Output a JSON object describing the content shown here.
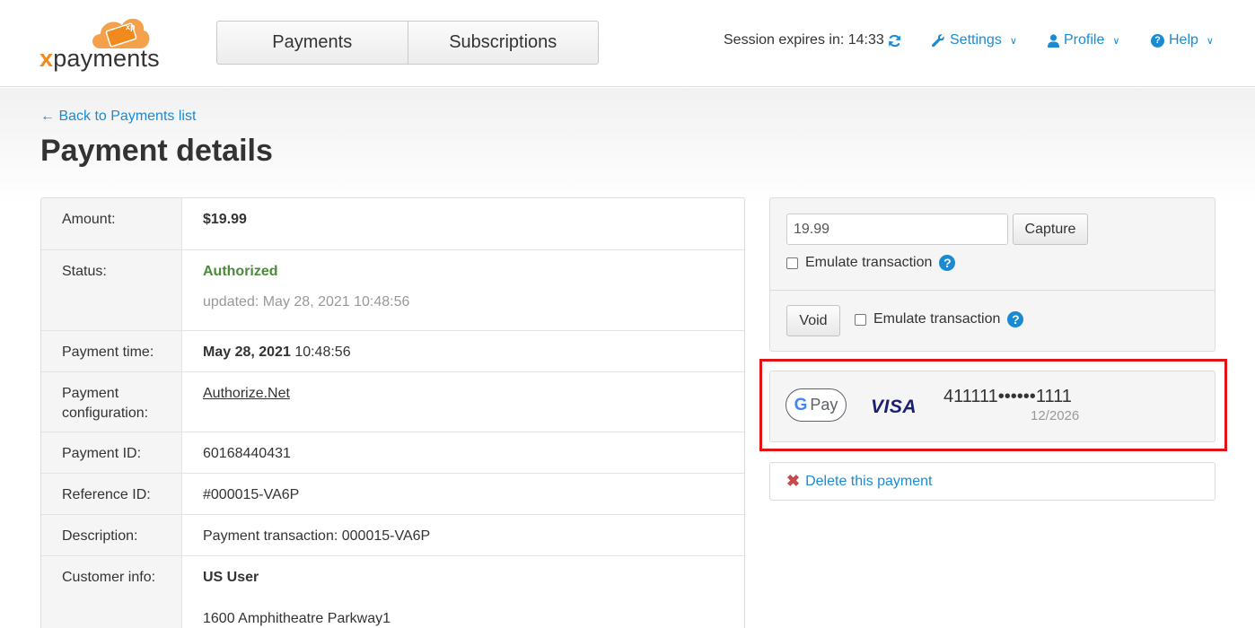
{
  "brand": {
    "logo_prefix": "x",
    "logo_name": "payments",
    "cloud_text": "xp",
    "accent": "#f08a1c"
  },
  "nav": {
    "tabs": [
      "Payments",
      "Subscriptions"
    ],
    "session_label": "Session expires in: 14:33",
    "refresh_icon": "refresh-icon",
    "settings": "Settings",
    "profile": "Profile",
    "help": "Help"
  },
  "page": {
    "back_link": "← Back to Payments list",
    "title": "Payment details"
  },
  "details": {
    "amount": {
      "label": "Amount:",
      "value": "$19.99"
    },
    "status": {
      "label": "Status:",
      "value": "Authorized",
      "updated": "updated: May 28, 2021 10:48:56"
    },
    "payment_time": {
      "label": "Payment time:",
      "date": "May 28, 2021",
      "time": "10:48:56"
    },
    "configuration": {
      "label_line1": "Payment",
      "label_line2": "configuration:",
      "value": "Authorize.Net"
    },
    "payment_id": {
      "label": "Payment ID:",
      "value": "60168440431"
    },
    "reference_id": {
      "label": "Reference ID:",
      "value": "#000015-VA6P"
    },
    "description": {
      "label": "Description:",
      "value": "Payment transaction: 000015-VA6P"
    },
    "customer": {
      "label": "Customer info:",
      "name": "US User",
      "address": "1600 Amphitheatre Parkway1"
    }
  },
  "actions": {
    "capture_amount": "19.99",
    "capture_label": "Capture",
    "emulate_label": "Emulate transaction",
    "void_label": "Void"
  },
  "card": {
    "wallet_g": "G",
    "wallet_pay": "Pay",
    "brand": "VISA",
    "number": "411111••••••1111",
    "expiry": "12/2026"
  },
  "delete": {
    "label": "Delete this payment"
  },
  "colors": {
    "link": "#1a8bd3",
    "status_ok": "#4b8a3a",
    "highlight": "#e01414"
  }
}
